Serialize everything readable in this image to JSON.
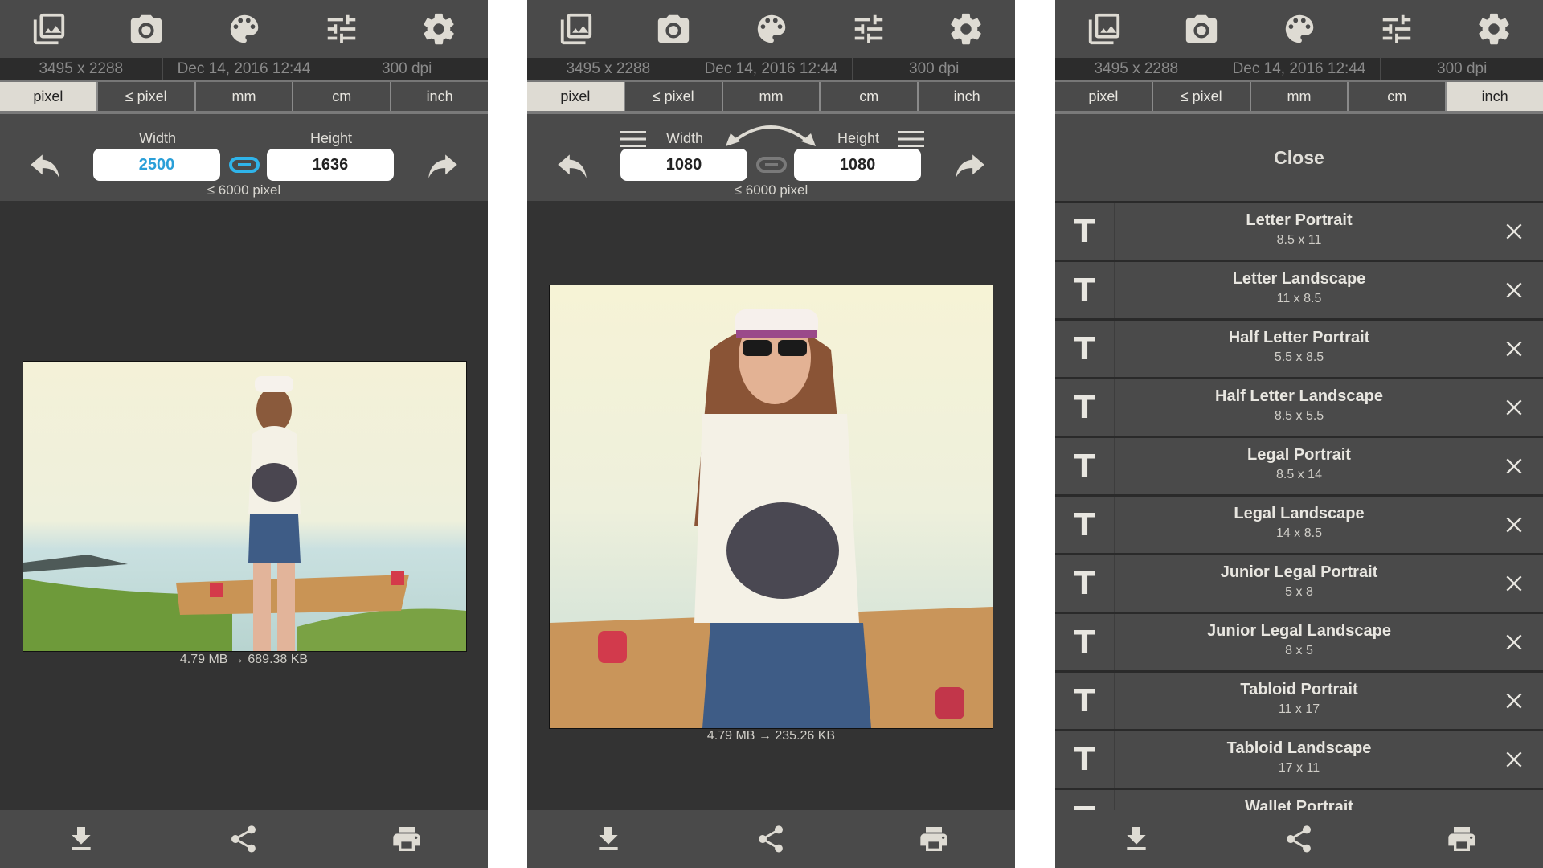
{
  "colors": {
    "toolbar_bg": "#4a4a4a",
    "content_bg": "#333333",
    "info_bg": "#2c2c2c",
    "active_tab_bg": "#dedbd3",
    "accent_blue": "#2a9fd8",
    "icon_color": "#dedbd3"
  },
  "toolbar_icons": [
    "gallery-icon",
    "camera-icon",
    "palette-icon",
    "tune-sliders-icon",
    "settings-gear-icon"
  ],
  "info": {
    "dimensions": "3495 x 2288",
    "date": "Dec 14, 2016 12:44",
    "dpi": "300 dpi"
  },
  "unit_tabs": [
    "pixel",
    "≤ pixel",
    "mm",
    "cm",
    "inch"
  ],
  "panels": [
    {
      "active_tab": "pixel",
      "width_label": "Width",
      "height_label": "Height",
      "width_value": "2500",
      "height_value": "1636",
      "aspect_linked": true,
      "limit": "≤ 6000 pixel",
      "size_caption": "4.79 MB → 689.38 KB"
    },
    {
      "active_tab": "pixel",
      "width_label": "Width",
      "height_label": "Height",
      "width_value": "1080",
      "height_value": "1080",
      "aspect_linked": false,
      "limit": "≤ 6000 pixel",
      "size_caption": "4.79 MB → 235.26 KB"
    },
    {
      "active_tab": "inch",
      "close_label": "Close",
      "presets": [
        {
          "name": "Letter Portrait",
          "dims": "8.5 x 11"
        },
        {
          "name": "Letter Landscape",
          "dims": "11 x 8.5"
        },
        {
          "name": "Half Letter Portrait",
          "dims": "5.5 x 8.5"
        },
        {
          "name": "Half Letter Landscape",
          "dims": "8.5 x 5.5"
        },
        {
          "name": "Legal Portrait",
          "dims": "8.5 x 14"
        },
        {
          "name": "Legal Landscape",
          "dims": "14 x 8.5"
        },
        {
          "name": "Junior Legal Portrait",
          "dims": "5 x 8"
        },
        {
          "name": "Junior Legal Landscape",
          "dims": "8 x 5"
        },
        {
          "name": "Tabloid Portrait",
          "dims": "11 x 17"
        },
        {
          "name": "Tabloid Landscape",
          "dims": "17 x 11"
        },
        {
          "name": "Wallet Portrait",
          "dims": ""
        }
      ]
    }
  ],
  "bottom_actions": [
    "save-download",
    "share",
    "print"
  ]
}
